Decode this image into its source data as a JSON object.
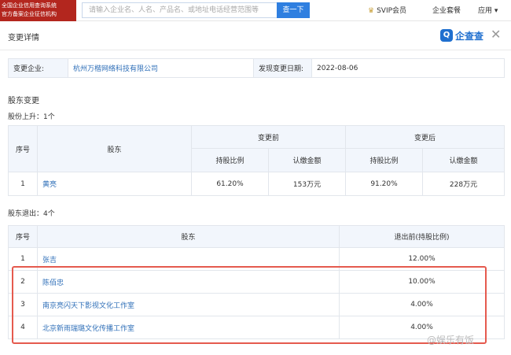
{
  "topbar": {
    "badge_line1": "全国企业信用查询系统",
    "badge_line2": "官方备案企业征信机构",
    "search_placeholder": "请输入企业名、人名、产品名、或地址电话经营范围等",
    "search_button": "查一下",
    "svip": "SVIP会员",
    "meal": "企业套餐",
    "apps": "应用"
  },
  "modal": {
    "title": "变更详情",
    "brand": "企查查",
    "close": "✕",
    "info": {
      "company_label": "变更企业:",
      "company_value": "杭州万楷网络科技有限公司",
      "date_label": "发现变更日期:",
      "date_value": "2022-08-06"
    },
    "section_title": "股东变更",
    "increase": {
      "subtitle": "股份上升：1个",
      "headers": {
        "index": "序号",
        "holder": "股东",
        "before": "变更前",
        "after": "变更后",
        "ratio": "持股比例",
        "amount": "认缴金额"
      },
      "rows": [
        {
          "index": "1",
          "holder": "黄亮",
          "before_ratio": "61.20%",
          "before_amount": "153万元",
          "after_ratio": "91.20%",
          "after_amount": "228万元"
        }
      ]
    },
    "exit": {
      "subtitle": "股东退出：4个",
      "headers": {
        "index": "序号",
        "holder": "股东",
        "ratio": "退出前(持股比例)"
      },
      "rows": [
        {
          "index": "1",
          "holder": "张吉",
          "ratio": "12.00%"
        },
        {
          "index": "2",
          "holder": "陈佰忠",
          "ratio": "10.00%"
        },
        {
          "index": "3",
          "holder": "南京亮闪天下影视文化工作室",
          "ratio": "4.00%"
        },
        {
          "index": "4",
          "holder": "北京新雨瑞璐文化传播工作室",
          "ratio": "4.00%"
        }
      ]
    }
  },
  "watermark": "@娱乐有饭",
  "colors": {
    "accent": "#2f7fe0",
    "badge": "#b3261e",
    "highlight": "#e55a4e",
    "link": "#2f6fb8"
  }
}
